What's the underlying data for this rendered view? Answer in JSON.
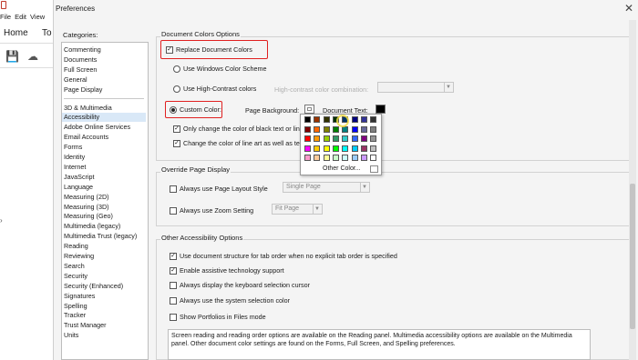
{
  "app": {
    "menu": [
      "File",
      "Edit",
      "View"
    ],
    "tabs": [
      "Home",
      "To"
    ]
  },
  "dialog": {
    "title": "Preferences",
    "categories_label": "Categories:",
    "categories_group1": [
      "Commenting",
      "Documents",
      "Full Screen",
      "General",
      "Page Display"
    ],
    "categories_group2": [
      "3D & Multimedia",
      "Accessibility",
      "Adobe Online Services",
      "Email Accounts",
      "Forms",
      "Identity",
      "Internet",
      "JavaScript",
      "Language",
      "Measuring (2D)",
      "Measuring (3D)",
      "Measuring (Geo)",
      "Multimedia (legacy)",
      "Multimedia Trust (legacy)",
      "Reading",
      "Reviewing",
      "Search",
      "Security",
      "Security (Enhanced)",
      "Signatures",
      "Spelling",
      "Tracker",
      "Trust Manager",
      "Units"
    ],
    "selected_category": "Accessibility"
  },
  "doc_colors": {
    "title": "Document Colors Options",
    "replace_label": "Replace Document Colors",
    "replace_checked": true,
    "windows_scheme_label": "Use Windows Color Scheme",
    "high_contrast_label": "Use High-Contrast colors",
    "high_contrast_combo_label": "High-contrast color combination:",
    "high_contrast_combo_value": "",
    "custom_color_label": "Custom Color:",
    "custom_color_selected": true,
    "page_background_label": "Page Background:",
    "document_text_label": "Document Text:",
    "only_black_text_label": "Only change the color of black text or line",
    "only_black_text_checked": true,
    "line_art_label": "Change the color of line art as well as text",
    "line_art_checked": true
  },
  "palette": {
    "colors": [
      [
        "#000000",
        "#993300",
        "#333300",
        "#003300",
        "#003366",
        "#000080",
        "#333399",
        "#333333"
      ],
      [
        "#800000",
        "#ff6600",
        "#808000",
        "#008000",
        "#008080",
        "#0000ff",
        "#666699",
        "#808080"
      ],
      [
        "#ff0000",
        "#ff9900",
        "#99cc00",
        "#339966",
        "#33cccc",
        "#3366ff",
        "#800080",
        "#969696"
      ],
      [
        "#ff00ff",
        "#ffcc00",
        "#ffff00",
        "#00ff00",
        "#00ffff",
        "#00ccff",
        "#993366",
        "#c0c0c0"
      ],
      [
        "#ff99cc",
        "#ffcc99",
        "#ffff99",
        "#ccffcc",
        "#ccffff",
        "#99ccff",
        "#cc99ff",
        "#ffffff"
      ]
    ],
    "other_label": "Other Color..."
  },
  "override": {
    "title": "Override Page Display",
    "page_layout_label": "Always use Page Layout Style",
    "page_layout_value": "Single Page",
    "zoom_label": "Always use Zoom Setting",
    "zoom_value": "Fit Page"
  },
  "other_access": {
    "title": "Other Accessibility Options",
    "items": [
      {
        "label": "Use document structure for tab order when no explicit tab order is specified",
        "checked": true
      },
      {
        "label": "Enable assistive technology support",
        "checked": true
      },
      {
        "label": "Always display the keyboard selection cursor",
        "checked": false
      },
      {
        "label": "Always use the system selection color",
        "checked": false
      },
      {
        "label": "Show Portfolios in Files mode",
        "checked": false
      }
    ],
    "info_text": "Screen reading and reading order options are available on the Reading panel. Multimedia accessibility options are available on the Multimedia panel. Other document color settings are found on the Forms, Full Screen, and Spelling preferences."
  },
  "colors": {
    "highlight_red": "#e02020",
    "selected_row": "#d9e8f7"
  }
}
